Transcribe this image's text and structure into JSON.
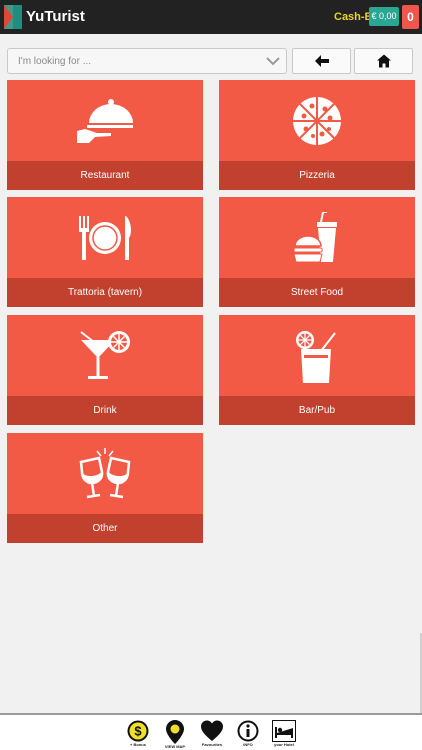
{
  "header": {
    "app_title": "YuTurist",
    "cash_label": "Cash-B",
    "cash_value": "€ 0,00",
    "notification_count": "0",
    "colors": {
      "bar": "#222222",
      "cash_label": "#e8d32a",
      "cash_badge": "#2aa693",
      "notif_badge": "#f0574a"
    }
  },
  "search": {
    "placeholder": "I'm looking for ..."
  },
  "nav": {
    "back_icon": "arrow-left-icon",
    "home_icon": "home-icon"
  },
  "categories": [
    {
      "label": "Restaurant",
      "icon": "cloche-icon"
    },
    {
      "label": "Pizzeria",
      "icon": "pizza-icon"
    },
    {
      "label": "Trattoria (tavern)",
      "icon": "fork-plate-knife-icon"
    },
    {
      "label": "Street Food",
      "icon": "burger-soda-icon"
    },
    {
      "label": "Drink",
      "icon": "cocktail-icon"
    },
    {
      "label": "Bar/Pub",
      "icon": "juice-glass-icon"
    },
    {
      "label": "Other",
      "icon": "wine-toast-icon"
    }
  ],
  "tile_colors": {
    "tile": "#f25a45",
    "label_bar": "#c2402e"
  },
  "bottom_nav": [
    {
      "label": "+ Bonus",
      "icon": "dollar-coin-icon"
    },
    {
      "label": "VIEW MAP",
      "icon": "map-pin-icon"
    },
    {
      "label": "Favourites",
      "icon": "heart-icon"
    },
    {
      "label": "INFO",
      "icon": "info-icon"
    },
    {
      "label": "your Hotel",
      "icon": "bed-icon"
    }
  ]
}
